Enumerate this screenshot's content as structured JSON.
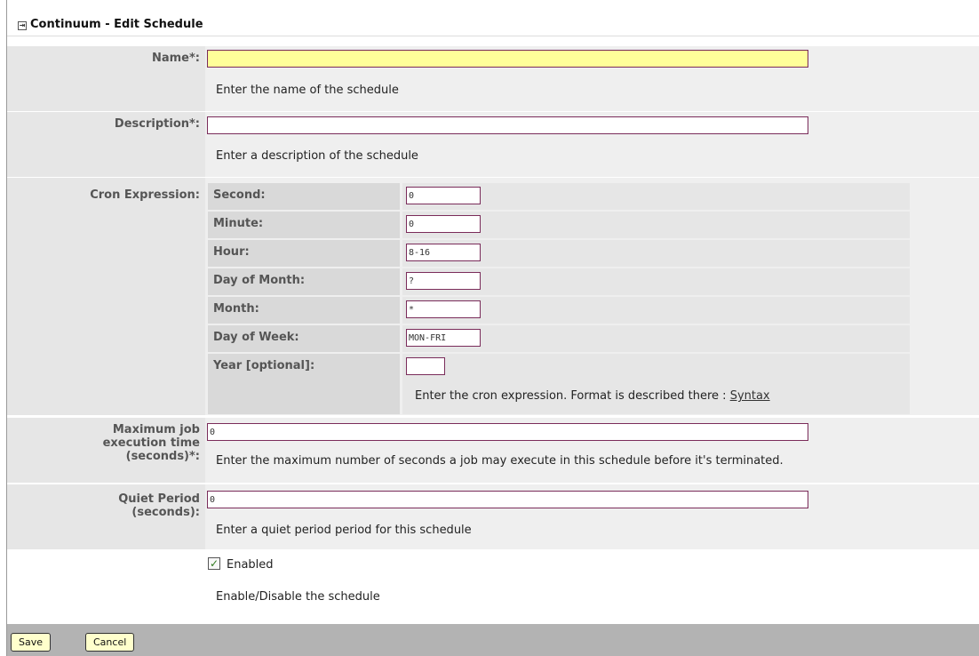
{
  "window": {
    "title": "Continuum - Edit Schedule"
  },
  "form": {
    "name": {
      "label": "Name*:",
      "value": "",
      "help": "Enter the name of the schedule"
    },
    "description": {
      "label": "Description*:",
      "value": "",
      "help": "Enter a description of the schedule"
    },
    "cron": {
      "label": "Cron Expression:",
      "fields": [
        {
          "label": "Second:",
          "value": "0"
        },
        {
          "label": "Minute:",
          "value": "0"
        },
        {
          "label": "Hour:",
          "value": "8-16"
        },
        {
          "label": "Day of Month:",
          "value": "?"
        },
        {
          "label": "Month:",
          "value": "*"
        },
        {
          "label": "Day of Week:",
          "value": "MON-FRI"
        },
        {
          "label": "Year [optional]:",
          "value": ""
        }
      ],
      "help": "Enter the cron expression. Format is described there :",
      "help_link": "Syntax"
    },
    "max_exec": {
      "label_line1": "Maximum job",
      "label_line2": "execution time",
      "label_line3": "(seconds)*:",
      "value": "0",
      "help": "Enter the maximum number of seconds a job may execute in this schedule before it's terminated."
    },
    "quiet": {
      "label_line1": "Quiet Period",
      "label_line2": "(seconds):",
      "value": "0",
      "help": "Enter a quiet period period for this schedule"
    },
    "enabled": {
      "label": "Enabled",
      "checked": true,
      "help": "Enable/Disable the schedule"
    }
  },
  "buttons": {
    "save": "Save",
    "cancel": "Cancel"
  },
  "colors": {
    "focus_field": "#ffff99",
    "input_border": "#7a2c5a",
    "footer": "#b3b3b3",
    "checkbox_mark": "#2f7a1f"
  }
}
